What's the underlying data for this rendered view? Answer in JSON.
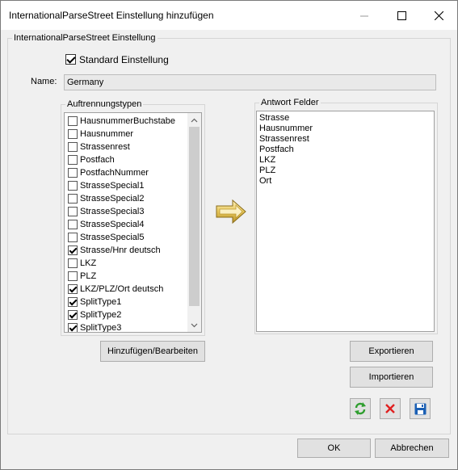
{
  "window": {
    "title": "InternationalParseStreet Einstellung hinzufügen",
    "controls": [
      "minimize-icon",
      "maximize-icon",
      "close-icon"
    ]
  },
  "main_group": {
    "legend": "InternationalParseStreet Einstellung",
    "standard_checkbox": {
      "label": "Standard Einstellung",
      "checked": true
    },
    "name_label": "Name:",
    "name_value": "Germany"
  },
  "split_types": {
    "legend": "Auftrennungstypen",
    "items": [
      {
        "label": "HausnummerBuchstabe",
        "checked": false
      },
      {
        "label": "Hausnummer",
        "checked": false
      },
      {
        "label": "Strassenrest",
        "checked": false
      },
      {
        "label": "Postfach",
        "checked": false
      },
      {
        "label": "PostfachNummer",
        "checked": false
      },
      {
        "label": "StrasseSpecial1",
        "checked": false
      },
      {
        "label": "StrasseSpecial2",
        "checked": false
      },
      {
        "label": "StrasseSpecial3",
        "checked": false
      },
      {
        "label": "StrasseSpecial4",
        "checked": false
      },
      {
        "label": "StrasseSpecial5",
        "checked": false
      },
      {
        "label": "Strasse/Hnr deutsch",
        "checked": true
      },
      {
        "label": "LKZ",
        "checked": false
      },
      {
        "label": "PLZ",
        "checked": false
      },
      {
        "label": "LKZ/PLZ/Ort deutsch",
        "checked": true
      },
      {
        "label": "SplitType1",
        "checked": true
      },
      {
        "label": "SplitType2",
        "checked": true
      },
      {
        "label": "SplitType3",
        "checked": true
      }
    ]
  },
  "answer_fields": {
    "legend": "Antwort Felder",
    "lines": [
      "Strasse",
      "Hausnummer",
      "Strassenrest",
      "Postfach",
      "LKZ",
      "PLZ",
      "Ort"
    ]
  },
  "buttons": {
    "add_edit": "Hinzufügen/Bearbeiten",
    "export": "Exportieren",
    "import": "Importieren",
    "ok": "OK",
    "cancel": "Abbrechen"
  },
  "icons": {
    "transfer": "arrow-right-icon",
    "refresh": "refresh-icon",
    "delete": "delete-icon",
    "save": "save-icon"
  },
  "colors": {
    "refresh_green": "#2e9e2e",
    "delete_red": "#e02020",
    "save_blue": "#1a5fb4",
    "arrow_gold": "#e6c65a"
  }
}
